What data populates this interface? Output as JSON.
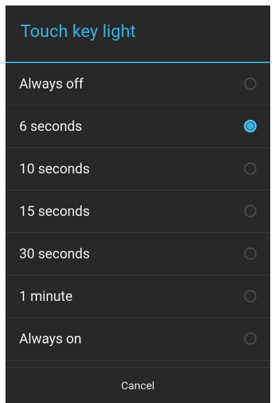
{
  "dialog": {
    "title": "Touch key light",
    "accent_color": "#33b5e5",
    "options": [
      {
        "label": "Always off",
        "selected": false
      },
      {
        "label": "6 seconds",
        "selected": true
      },
      {
        "label": "10 seconds",
        "selected": false
      },
      {
        "label": "15 seconds",
        "selected": false
      },
      {
        "label": "30 seconds",
        "selected": false
      },
      {
        "label": "1 minute",
        "selected": false
      },
      {
        "label": "Always on",
        "selected": false
      }
    ],
    "cancel_label": "Cancel"
  }
}
